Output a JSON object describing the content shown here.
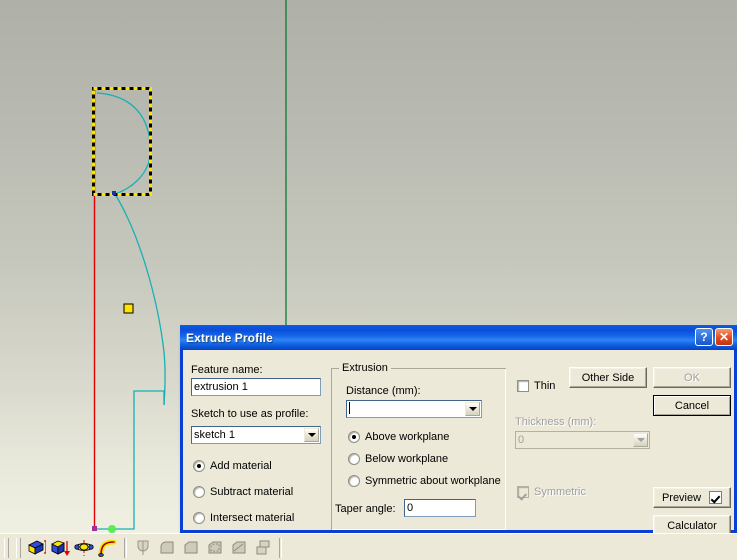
{
  "viewport": {
    "name": "cad-sketch-viewport",
    "background_top": "#afb0a8",
    "background_bottom": "#efefe2",
    "geometry_colors": {
      "profile_curve": "#17b0b4",
      "axis_vertical_red": "#e00000",
      "axis_vertical_green": "#0f7a34",
      "selection_dash_a": "#000000",
      "selection_dash_b": "#ffe400",
      "origin_point": "#55ee55",
      "end_point": "#a0309a",
      "handle_square_fill": "#ffe400"
    }
  },
  "dialog": {
    "title": "Extrude Profile",
    "help_button": "?",
    "close_button": "✕",
    "feature_name": {
      "label": "Feature name:",
      "label_underline_index": 0,
      "value": "extrusion 1"
    },
    "sketch_profile": {
      "label": "Sketch to use as profile:",
      "value": "sketch 1",
      "arrow_icon": "chevron-down-icon"
    },
    "material_options": [
      {
        "label": "Add material",
        "selected": true
      },
      {
        "label": "Subtract material",
        "selected": false
      },
      {
        "label": "Intersect material",
        "selected": false
      }
    ],
    "extrusion_group": {
      "title": "Extrusion",
      "distance": {
        "label": "Distance (mm):",
        "value": "",
        "arrow_icon": "chevron-down-icon"
      },
      "direction_options": [
        {
          "label": "Above workplane",
          "selected": true
        },
        {
          "label": "Below workplane",
          "selected": false
        },
        {
          "label": "Symmetric about workplane",
          "selected": false
        }
      ],
      "taper_angle": {
        "label": "Taper angle:",
        "value": "0"
      }
    },
    "thin_section": {
      "thin": {
        "label": "Thin",
        "checked": false,
        "enabled": true
      },
      "thickness": {
        "label": "Thickness (mm):",
        "value": "0",
        "enabled": false,
        "arrow_icon": "chevron-down-icon"
      },
      "symmetric": {
        "label": "Symmetric",
        "checked": true,
        "enabled": false
      }
    },
    "buttons": {
      "other_side": {
        "label": "Other Side",
        "enabled": true
      },
      "ok": {
        "label": "OK",
        "enabled": false
      },
      "cancel": {
        "label": "Cancel",
        "enabled": true,
        "is_default": true
      },
      "preview": {
        "label": "Preview",
        "checked": true
      },
      "calculator": {
        "label": "Calculator"
      }
    }
  },
  "toolbar": {
    "name": "feature-toolbar",
    "buttons": [
      {
        "name": "extrude-boss-icon",
        "tooltip": "Extrude Boss",
        "enabled": true
      },
      {
        "name": "extrude-cut-icon",
        "tooltip": "Extrude Cut",
        "enabled": true
      },
      {
        "name": "revolve-icon",
        "tooltip": "Revolve Boss",
        "enabled": true
      },
      {
        "name": "sweep-icon",
        "tooltip": "Sweep Boss",
        "enabled": true
      },
      {
        "name": "hole-icon",
        "tooltip": "Hole",
        "enabled": false
      },
      {
        "name": "fillet-icon",
        "tooltip": "Fillet",
        "enabled": false
      },
      {
        "name": "chamfer-icon",
        "tooltip": "Chamfer",
        "enabled": false
      },
      {
        "name": "shell-icon",
        "tooltip": "Shell",
        "enabled": false
      },
      {
        "name": "draft-icon",
        "tooltip": "Draft",
        "enabled": false
      },
      {
        "name": "pattern-icon",
        "tooltip": "Pattern",
        "enabled": false
      }
    ]
  }
}
